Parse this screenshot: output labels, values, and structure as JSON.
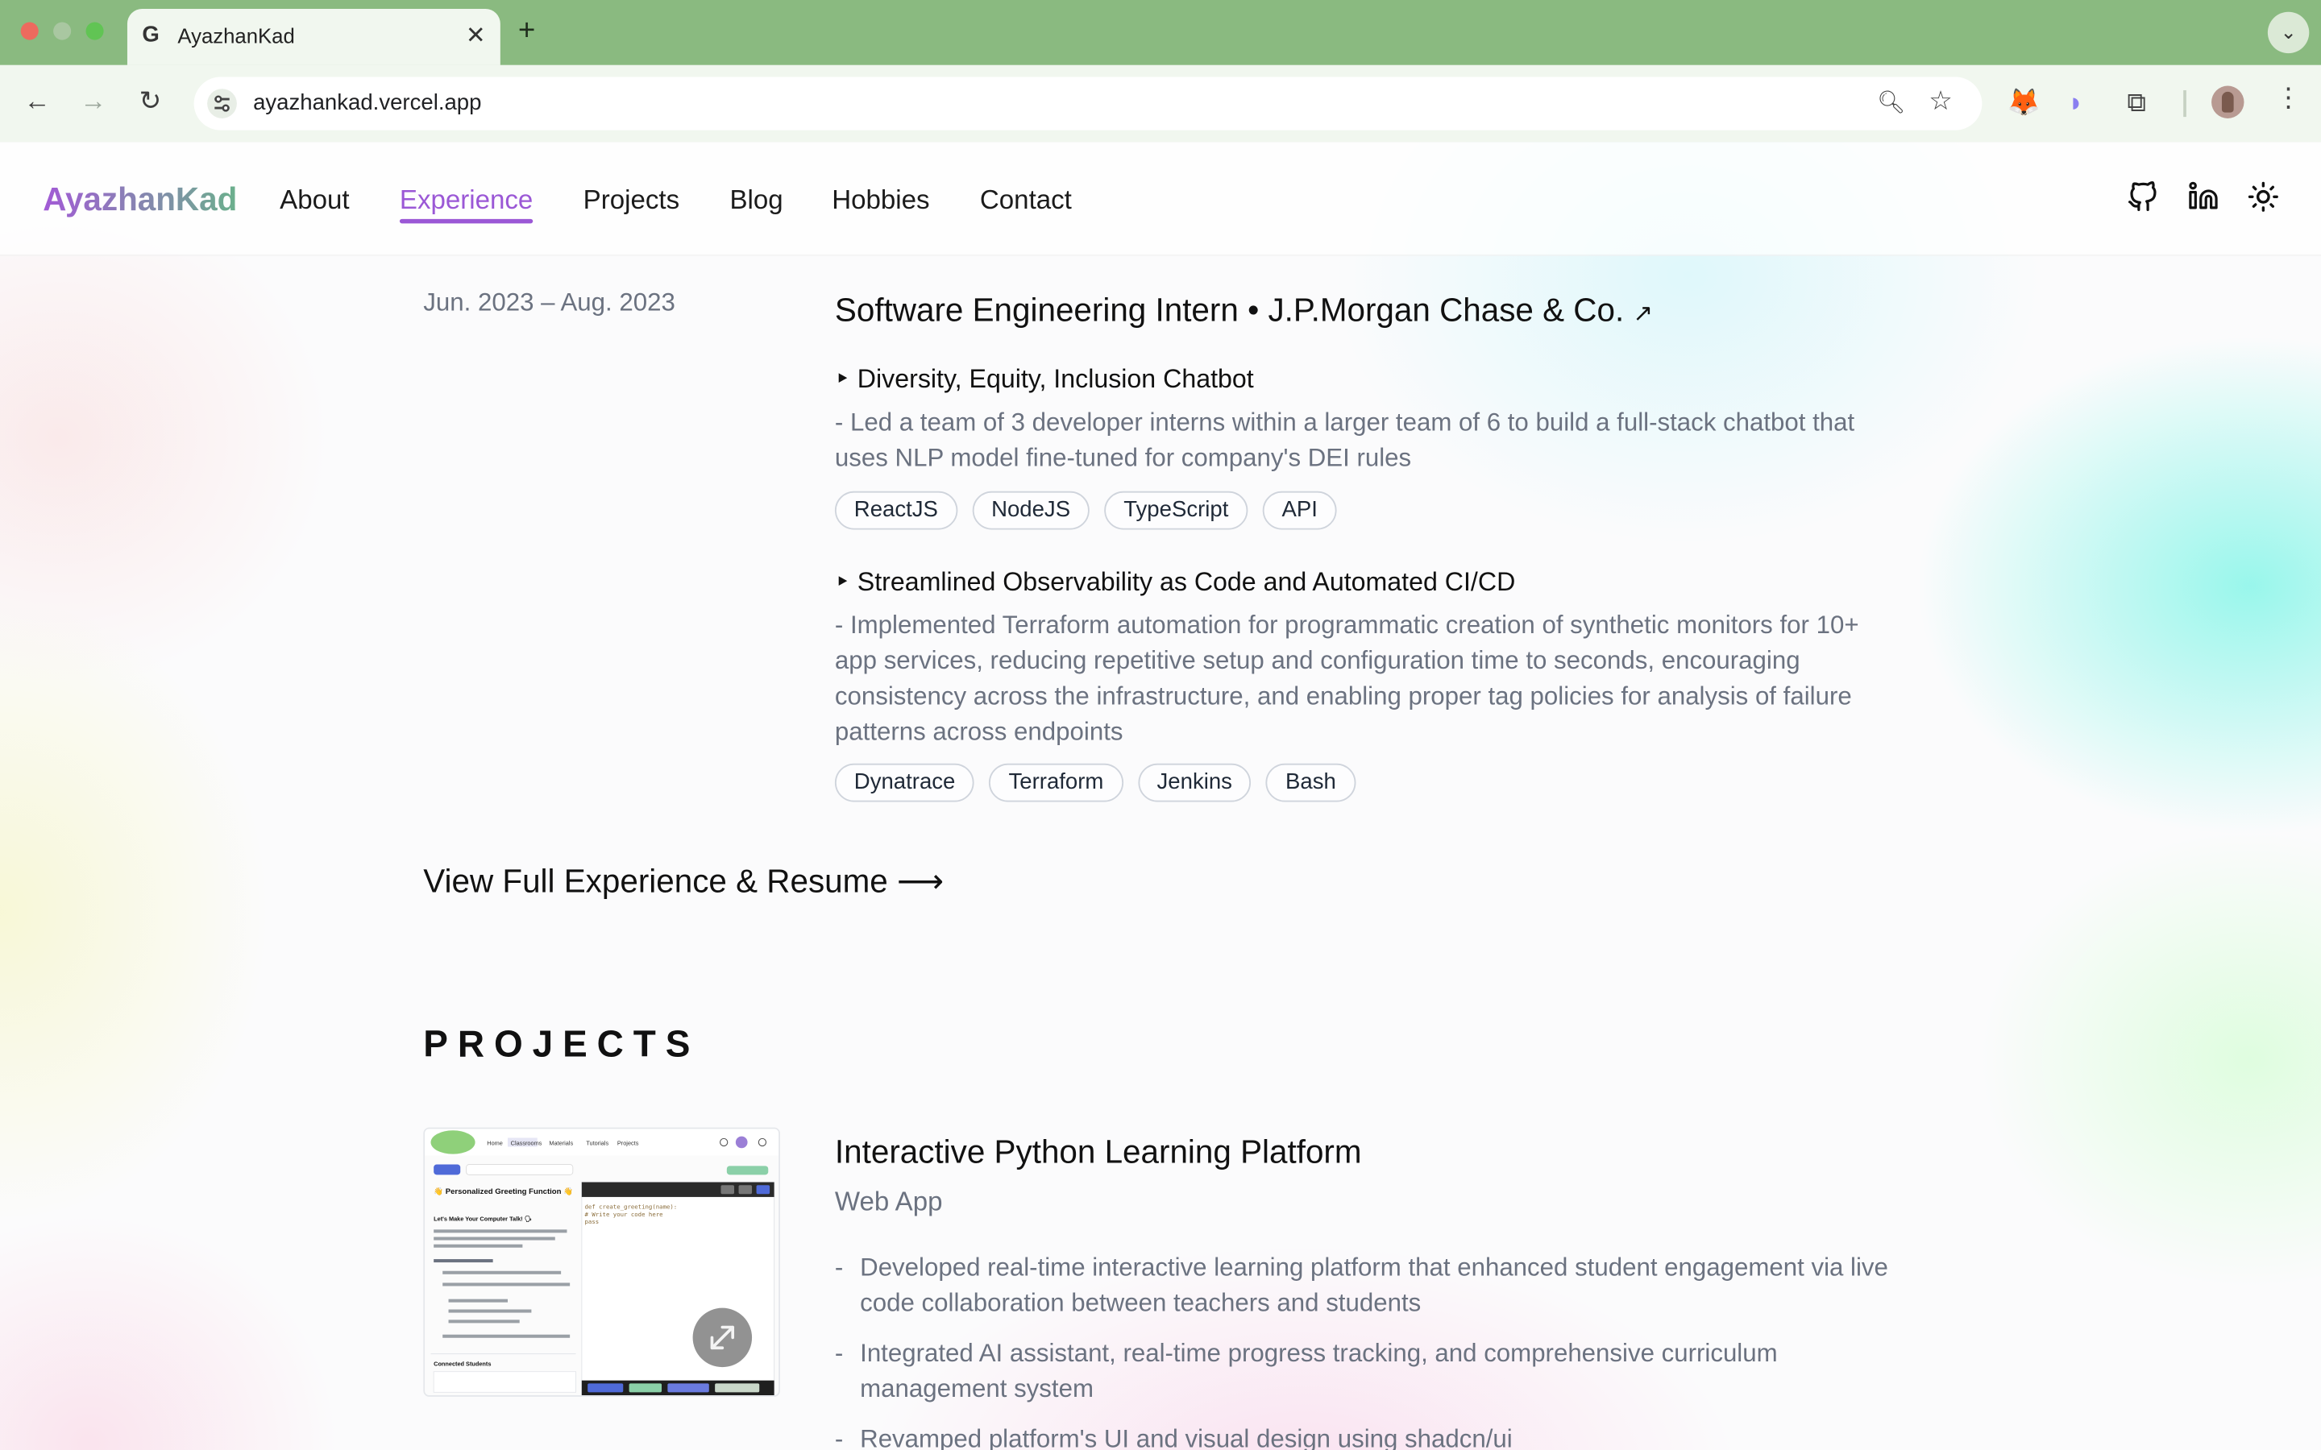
{
  "browser": {
    "tab_title": "AyazhanKad",
    "tab_favicon": "G",
    "url": "ayazhankad.vercel.app",
    "tab_close": "✕",
    "new_tab": "+",
    "tab_menu": "⌄"
  },
  "nav": {
    "brand": "AyazhanKad",
    "links": [
      "About",
      "Experience",
      "Projects",
      "Blog",
      "Hobbies",
      "Contact"
    ],
    "active": "Experience",
    "icons": [
      "github-icon",
      "linkedin-icon",
      "theme-toggle-sun-icon"
    ]
  },
  "experience": {
    "date": "Jun. 2023 – Aug. 2023",
    "title": "Software Engineering Intern • J.P.Morgan Chase & Co.",
    "title_arrow": "↗",
    "projects": [
      {
        "title": "‣ Diversity, Equity, Inclusion Chatbot",
        "description": "- Led a team of 3 developer interns within a larger team of 6 to build a full-stack chatbot that uses NLP model fine-tuned for company's DEI rules",
        "tags": [
          "ReactJS",
          "NodeJS",
          "TypeScript",
          "API"
        ]
      },
      {
        "title": "‣ Streamlined Observability as Code and Automated CI/CD",
        "description": "- Implemented Terraform automation for programmatic creation of synthetic monitors for 10+ app services, reducing repetitive setup and configuration time to seconds, encouraging consistency across the infrastructure, and enabling proper tag policies for analysis of failure patterns across endpoints",
        "tags": [
          "Dynatrace",
          "Terraform",
          "Jenkins",
          "Bash"
        ]
      }
    ],
    "view_full": "View Full Experience & Resume ⟶"
  },
  "projects": {
    "heading": "PROJECTS",
    "items": [
      {
        "title": "Interactive Python Learning Platform",
        "subtitle": "Web App",
        "points": [
          "Developed real-time interactive learning platform that enhanced student engagement via live code collaboration between teachers and students",
          "Integrated AI assistant, real-time progress tracking, and comprehensive curriculum management system",
          "Revamped platform's UI and visual design using shadcn/ui"
        ],
        "thumbnail": {
          "nav": [
            "Home",
            "Classrooms",
            "Materials",
            "Tutorials",
            "Projects"
          ],
          "heading": "👋 Personalized Greeting Function 👋",
          "subheading": "Let's Make Your Computer Talk! 🗣",
          "code": [
            "def create_greeting(name):",
            "    # Write your code here",
            "    pass"
          ],
          "connected": "Connected Students"
        }
      }
    ]
  },
  "colors": {
    "accent": "#9b58d6",
    "brand_gradient_start": "#a25ad6",
    "brand_gradient_end": "#6bb08c",
    "chrome_frame": "#8aba80",
    "muted_text": "#6b7280"
  }
}
